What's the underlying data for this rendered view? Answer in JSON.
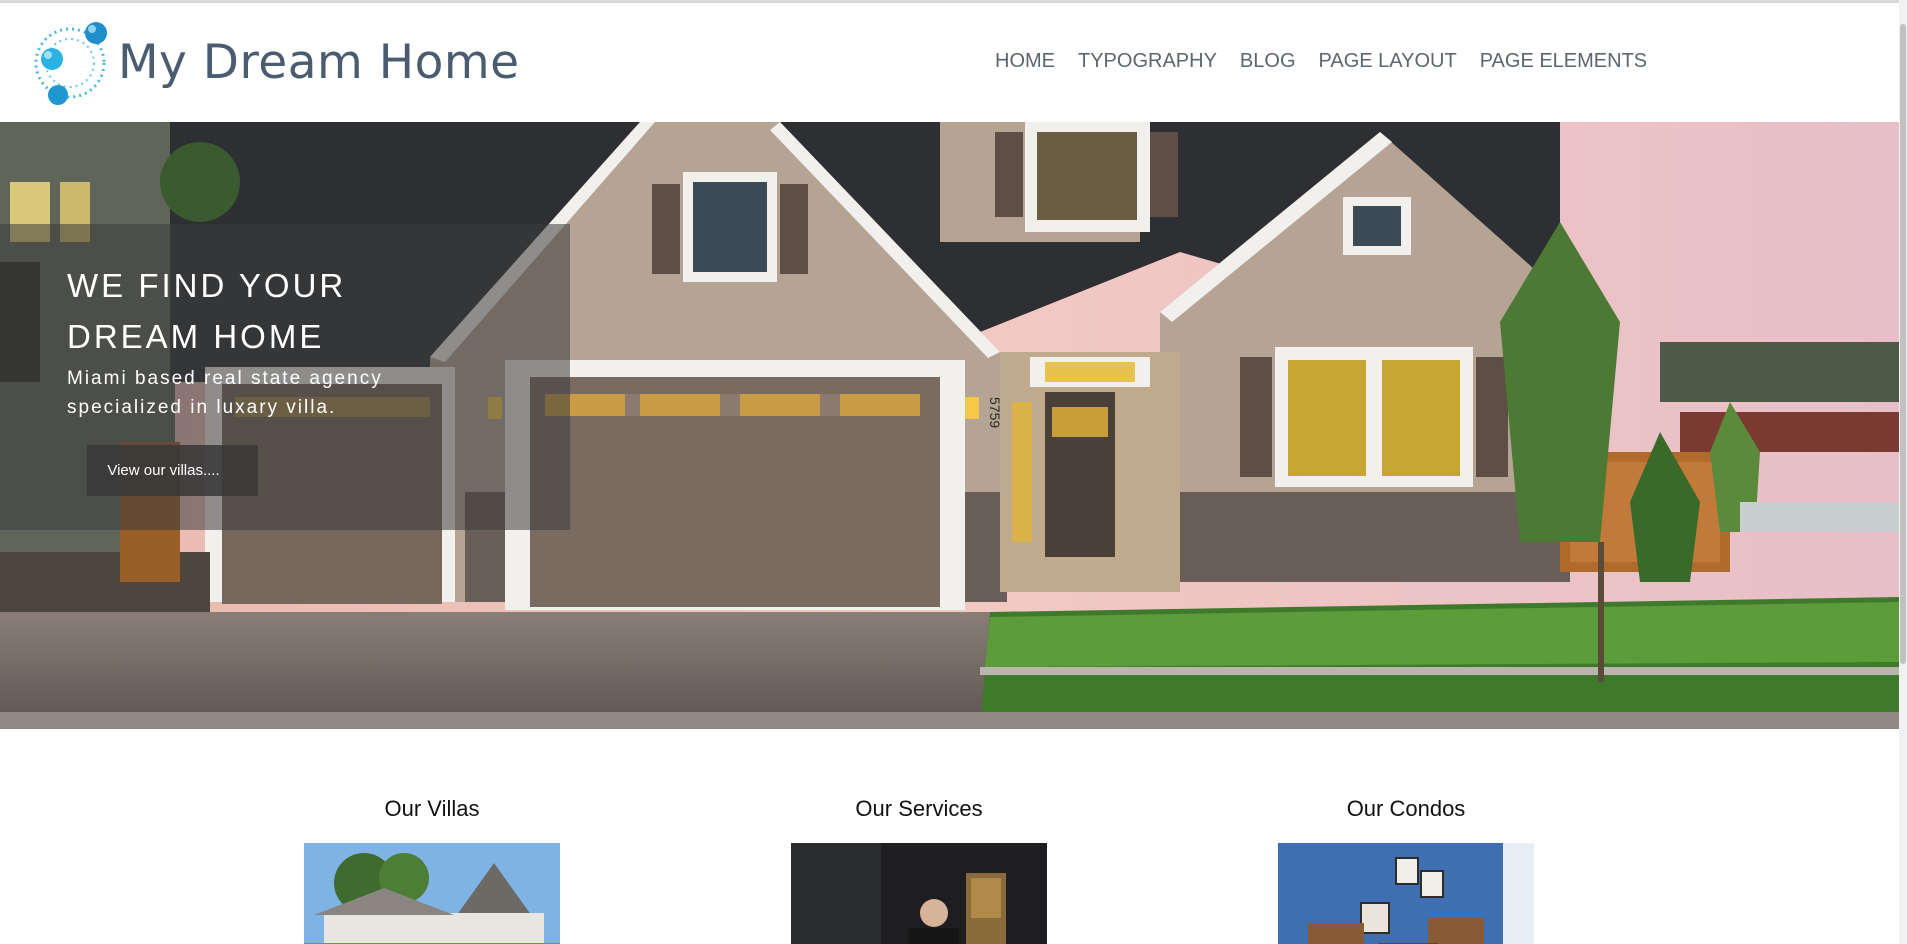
{
  "brand": {
    "name": "My Dream Home"
  },
  "nav": {
    "items": [
      {
        "label": "HOME"
      },
      {
        "label": "TYPOGRAPHY"
      },
      {
        "label": "BLOG"
      },
      {
        "label": "PAGE LAYOUT"
      },
      {
        "label": "PAGE ELEMENTS"
      }
    ]
  },
  "hero": {
    "title": "WE FIND YOUR DREAM HOME",
    "subtitle": "Miami based real state agency specialized in luxary villa.",
    "button_label": "View our villas....",
    "house_number": "5759"
  },
  "features": [
    {
      "title": "Our Villas"
    },
    {
      "title": "Our Services"
    },
    {
      "title": "Our Condos"
    }
  ],
  "colors": {
    "brand_text": "#4a5d70",
    "logo_accent": "#1aa6d6",
    "nav_text": "#5b6670",
    "overlay": "#3c3c3c"
  }
}
